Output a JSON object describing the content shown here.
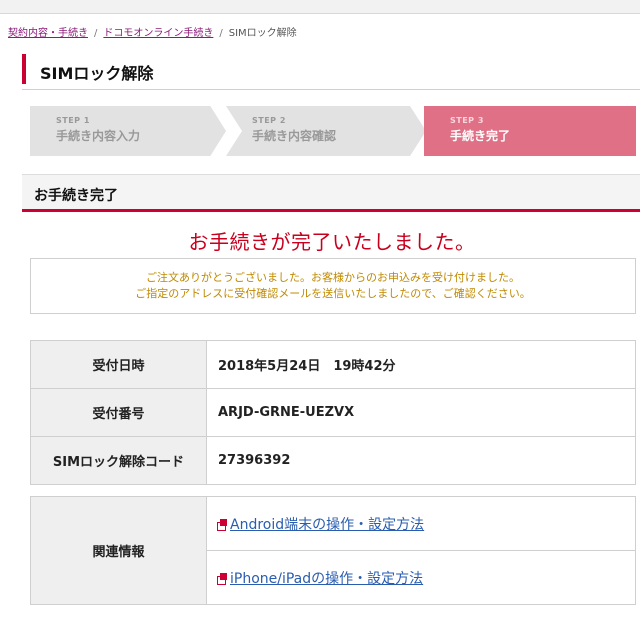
{
  "breadcrumb": {
    "items": [
      "契約内容・手続き",
      "ドコモオンライン手続き",
      "SIMロック解除"
    ],
    "separator": "/"
  },
  "page": {
    "title": "SIMロック解除"
  },
  "steps": [
    {
      "num": "STEP 1",
      "label": "手続き内容入力",
      "state": "done"
    },
    {
      "num": "STEP 2",
      "label": "手続き内容確認",
      "state": "done"
    },
    {
      "num": "STEP 3",
      "label": "手続き完了",
      "state": "current"
    }
  ],
  "section": {
    "title": "お手続き完了"
  },
  "complete_message": "お手続きが完了いたしました。",
  "notice": {
    "line1": "ご注文ありがとうございました。お客様からのお申込みを受け付けました。",
    "line2": "ご指定のアドレスに受付確認メールを送信いたしましたので、ご確認ください。"
  },
  "info": [
    {
      "label": "受付日時",
      "value": "2018年5月24日　19時42分"
    },
    {
      "label": "受付番号",
      "value": "ARJD-GRNE-UEZVX"
    },
    {
      "label": "SIMロック解除コード",
      "value": "27396392"
    }
  ],
  "related": {
    "label": "関連情報",
    "links": [
      "Android端末の操作・設定方法",
      "iPhone/iPadの操作・設定方法"
    ]
  },
  "colors": {
    "accent": "#cc0033",
    "step_current": "#e07086",
    "step_inactive": "#e2e2e2",
    "notice_text": "#c08a00",
    "complete_text": "#c8001e",
    "link": "#2a5db0"
  },
  "icons": {
    "related_link": "external-window-icon"
  }
}
